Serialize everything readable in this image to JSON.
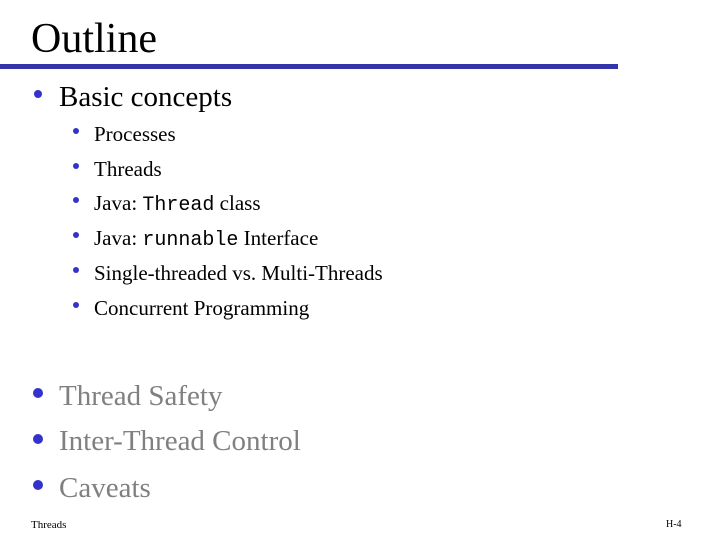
{
  "slide": {
    "title": "Outline",
    "accent_color": "#3333aa",
    "bullet_color": "#3333cc",
    "main_items": [
      {
        "label": "Basic concepts",
        "active": true
      },
      {
        "label": "Thread Safety",
        "active": false
      },
      {
        "label": "Inter-Thread Control",
        "active": false
      },
      {
        "label": "Caveats",
        "active": false
      }
    ],
    "sub_items": [
      {
        "text": "Processes"
      },
      {
        "text": "Threads"
      },
      {
        "prefix": "Java: ",
        "code": "Thread",
        "suffix": " class"
      },
      {
        "prefix": "Java: ",
        "code": "runnable",
        "suffix": " Interface"
      },
      {
        "text": "Single-threaded vs. Multi-Threads"
      },
      {
        "text": "Concurrent Programming"
      }
    ],
    "footer_left": "Threads",
    "footer_right": "H-4"
  }
}
